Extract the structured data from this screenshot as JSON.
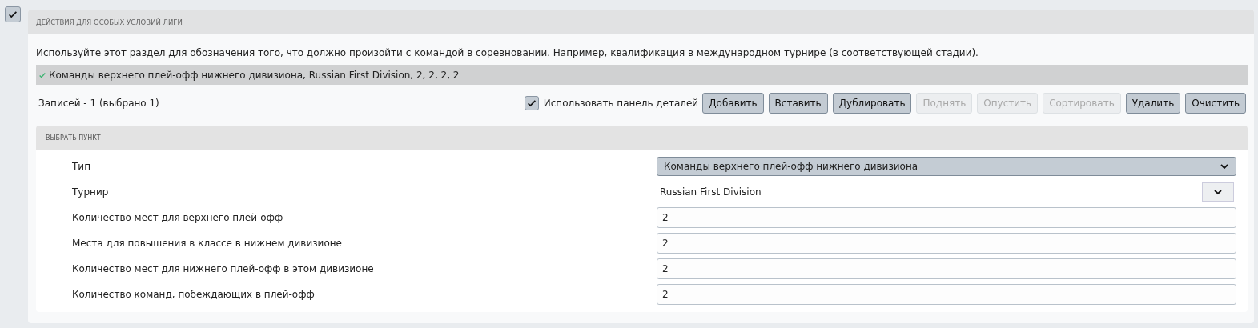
{
  "enabled": {
    "checked": true
  },
  "section": {
    "title": "ДЕЙСТВИЯ ДЛЯ ОСОБЫХ УСЛОВИЙ ЛИГИ",
    "description": "Используйте этот раздел для обозначения того, что должно произойти с командой в соревновании. Например, квалификация в международном турнире (в соответствующей стадии).",
    "list": [
      {
        "text": "Команды верхнего плей-офф нижнего дивизиона, Russian First Division, 2, 2, 2, 2",
        "selected": true
      }
    ],
    "records": "Записей - 1 (выбрано 1)",
    "details_panel": {
      "label": "Использовать панель деталей",
      "checked": true
    },
    "buttons": [
      {
        "label": "Добавить",
        "disabled": false
      },
      {
        "label": "Вставить",
        "disabled": false
      },
      {
        "label": "Дублировать",
        "disabled": false
      },
      {
        "label": "Поднять",
        "disabled": true
      },
      {
        "label": "Опустить",
        "disabled": true
      },
      {
        "label": "Сортировать",
        "disabled": true
      },
      {
        "label": "Удалить",
        "disabled": false
      },
      {
        "label": "Очистить",
        "disabled": false
      }
    ]
  },
  "item_panel": {
    "title": "ВЫБРАТЬ ПУНКТ",
    "fields": [
      {
        "kind": "select",
        "label": "Тип",
        "value": "Команды верхнего плей-офф нижнего дивизиона"
      },
      {
        "kind": "combo",
        "label": "Турнир",
        "value": "Russian First Division"
      },
      {
        "kind": "input",
        "label": "Количество мест для верхнего плей-офф",
        "value": "2"
      },
      {
        "kind": "input",
        "label": "Места для повышения в классе в нижнем дивизионе",
        "value": "2"
      },
      {
        "kind": "input",
        "label": "Количество мест для нижнего плей-офф в этом дивизионе",
        "value": "2"
      },
      {
        "kind": "input",
        "label": "Количество команд, побеждающих в плей-офф",
        "value": "2"
      }
    ]
  }
}
